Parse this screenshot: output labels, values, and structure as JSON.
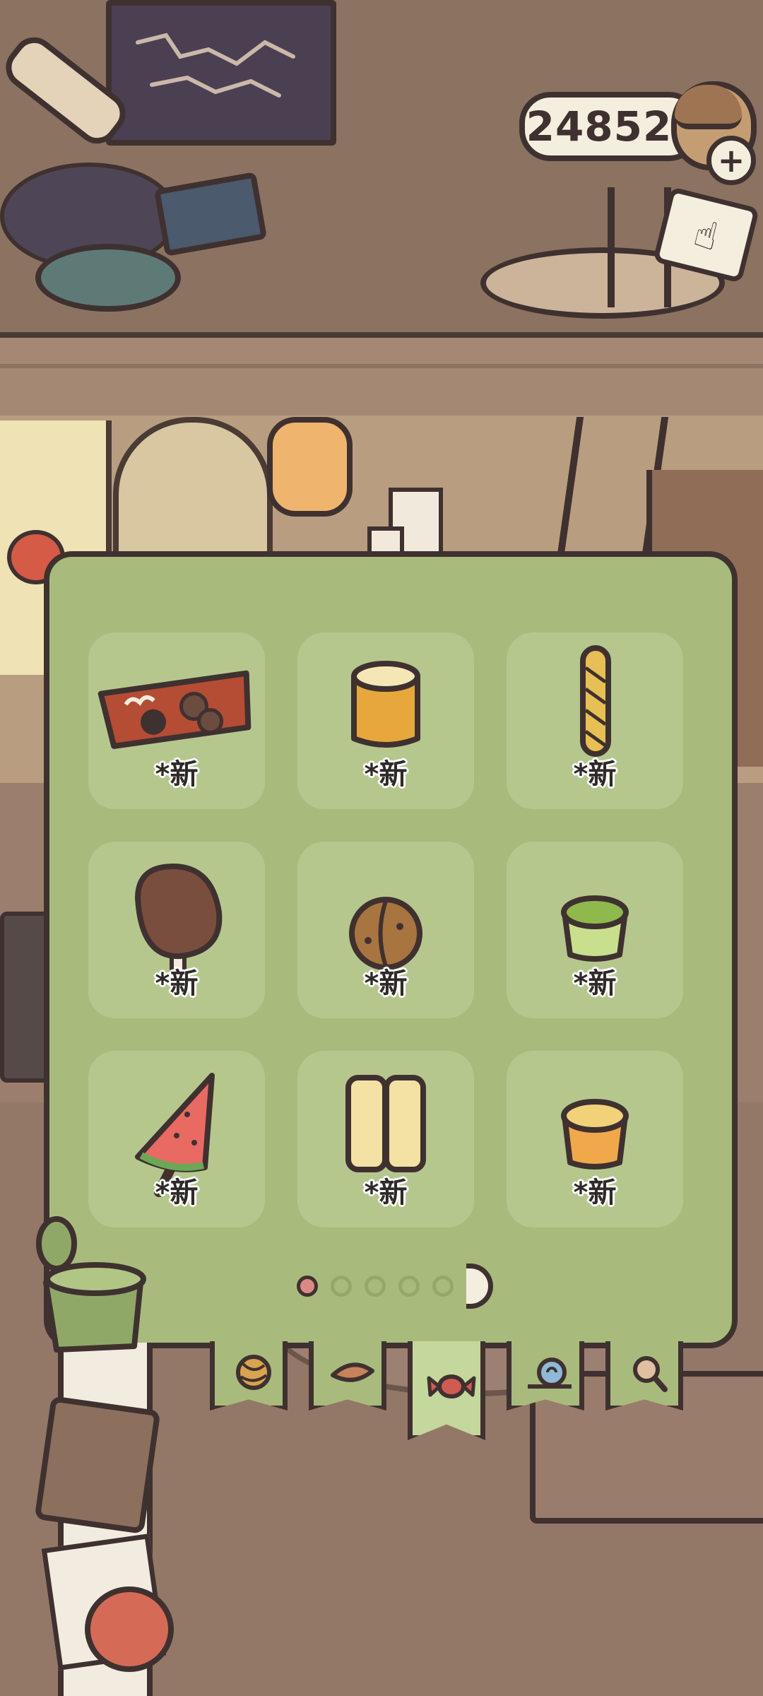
{
  "header": {
    "coin_count": "24852",
    "add_coins_symbol": "+"
  },
  "panel": {
    "page_index": 1,
    "page_count": 5,
    "items": [
      {
        "name": "chocolate-bar",
        "label": "*新"
      },
      {
        "name": "marshmallow",
        "label": "*新"
      },
      {
        "name": "twisted-bread-stick",
        "label": "*新"
      },
      {
        "name": "chocolate-popsicle",
        "label": "*新"
      },
      {
        "name": "walnut",
        "label": "*新"
      },
      {
        "name": "matcha-pudding",
        "label": "*新"
      },
      {
        "name": "watermelon-popsicle",
        "label": "*新"
      },
      {
        "name": "twin-popsicle",
        "label": "*新"
      },
      {
        "name": "orange-pudding",
        "label": "*新"
      }
    ]
  },
  "tabs": [
    {
      "name": "yarn-ball-icon",
      "active": false
    },
    {
      "name": "leaf-icon",
      "active": false
    },
    {
      "name": "candy-icon",
      "active": true
    },
    {
      "name": "snail-icon",
      "active": false
    },
    {
      "name": "magnifier-icon",
      "active": false
    }
  ],
  "colors": {
    "panel": "#a8bb7c",
    "slot": "#b6c78e",
    "outline": "#3f3130",
    "active_dot": "#d98b83"
  }
}
